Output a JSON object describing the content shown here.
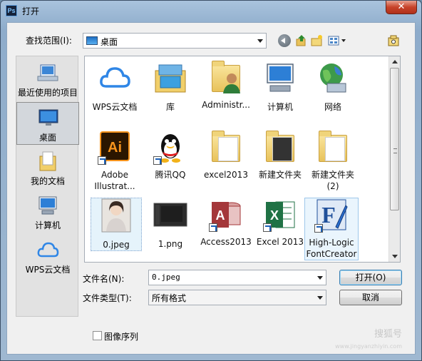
{
  "window": {
    "title": "打开",
    "app_icon": "Ps",
    "close_label": "✕"
  },
  "toolbar": {
    "look_in_label": "查找范围(I):",
    "look_in_value": "桌面"
  },
  "places": [
    {
      "label": "最近使用的项目",
      "icon": "recent-icon"
    },
    {
      "label": "桌面",
      "icon": "desktop-icon"
    },
    {
      "label": "我的文档",
      "icon": "documents-icon"
    },
    {
      "label": "计算机",
      "icon": "computer-icon"
    },
    {
      "label": "WPS云文档",
      "icon": "wps-cloud-icon"
    }
  ],
  "files": [
    {
      "label": "WPS云文档",
      "icon": "wps-cloud-icon"
    },
    {
      "label": "库",
      "icon": "library-icon"
    },
    {
      "label": "Administr...",
      "icon": "user-folder-icon"
    },
    {
      "label": "计算机",
      "icon": "computer-icon"
    },
    {
      "label": "网络",
      "icon": "network-icon"
    },
    {
      "label": "Adobe",
      "label2": "Illustrat...",
      "icon": "illustrator-icon"
    },
    {
      "label": "腾讯QQ",
      "icon": "qq-icon"
    },
    {
      "label": "excel2013",
      "icon": "folder-icon"
    },
    {
      "label": "新建文件夹",
      "icon": "folder-icon"
    },
    {
      "label": "新建文件夹",
      "label2": "(2)",
      "icon": "folder-icon"
    },
    {
      "label": "0.jpeg",
      "icon": "image-thumbnail-icon"
    },
    {
      "label": "1.png",
      "icon": "image-thumbnail-icon"
    },
    {
      "label": "Access2013",
      "icon": "access-icon"
    },
    {
      "label": "Excel 2013",
      "icon": "excel-icon"
    },
    {
      "label": "High-Logic",
      "label2": "FontCreator",
      "icon": "fontcreator-icon"
    }
  ],
  "form": {
    "filename_label": "文件名(N):",
    "filename_value": "0.jpeg",
    "filetype_label": "文件类型(T):",
    "filetype_value": "所有格式",
    "open_label": "打开(O)",
    "cancel_label": "取消",
    "sequence_label": "图像序列"
  },
  "watermark": {
    "text": "搜狐号",
    "sub": "www.jingyanzhiyin.com"
  },
  "colors": {
    "accent": "#3c7fb1",
    "selection": "#e5f3fb",
    "titlebar": "#a9c3dd",
    "close": "#c7432a"
  }
}
